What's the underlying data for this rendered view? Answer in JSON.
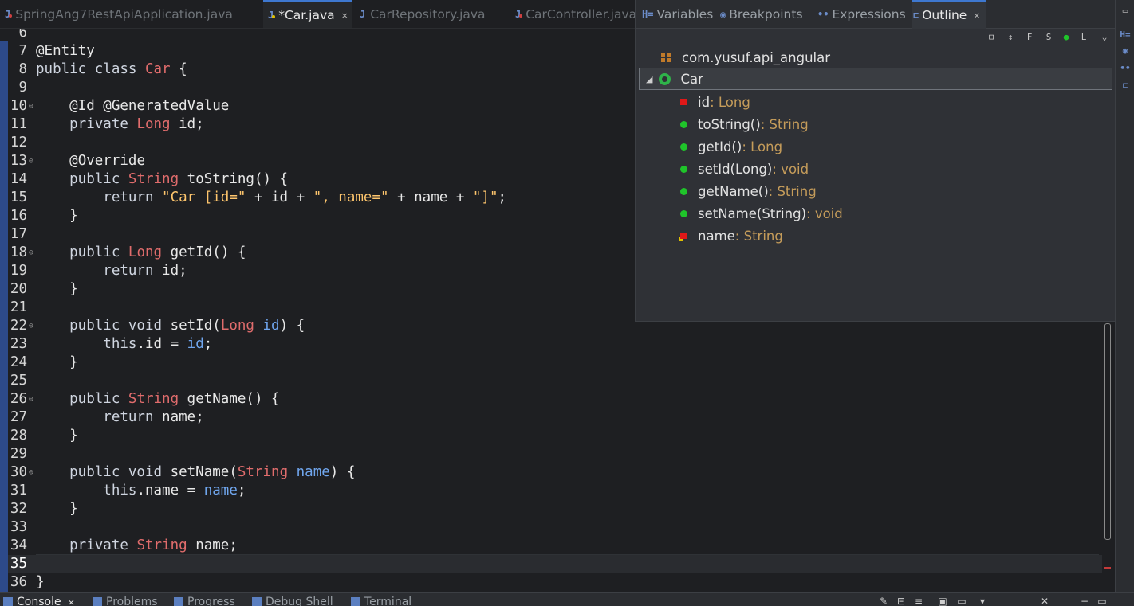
{
  "editor_tabs": [
    {
      "label": "SpringAng7RestApiApplication.java",
      "active": false,
      "marker": "error"
    },
    {
      "label": "*Car.java",
      "active": true,
      "marker": "warning",
      "close": "×"
    },
    {
      "label": "CarRepository.java",
      "active": false,
      "marker": "none"
    },
    {
      "label": "CarController.java",
      "active": false,
      "marker": "error"
    }
  ],
  "outline_tabs": [
    {
      "label": "Variables",
      "icon": "variables-icon",
      "glyph": "H="
    },
    {
      "label": "Breakpoints",
      "icon": "breakpoints-icon",
      "glyph": "◉"
    },
    {
      "label": "Expressions",
      "icon": "expressions-icon",
      "glyph": "••"
    },
    {
      "label": "Outline",
      "icon": "outline-icon",
      "glyph": "⊏",
      "close": "×"
    }
  ],
  "outline_toolbar": [
    "collapse-all-icon",
    "sort-icon",
    "hide-fields-icon",
    "hide-static-icon",
    "hide-nonpublic-icon",
    "hide-local-types-icon",
    "view-menu-icon"
  ],
  "outline": {
    "package": "com.yusuf.api_angular",
    "class_name": "Car",
    "members": [
      {
        "name": "id",
        "suffix": " : Long",
        "kind": "field"
      },
      {
        "name": "toString()",
        "suffix": " : String",
        "kind": "method-override"
      },
      {
        "name": "getId()",
        "suffix": " : Long",
        "kind": "method"
      },
      {
        "name": "setId(Long)",
        "suffix": " : void",
        "kind": "method"
      },
      {
        "name": "getName()",
        "suffix": " : String",
        "kind": "method"
      },
      {
        "name": "setName(String)",
        "suffix": " : void",
        "kind": "method"
      },
      {
        "name": "name",
        "suffix": " : String",
        "kind": "field-warning"
      }
    ]
  },
  "code": {
    "first_line_number": 6,
    "current_line": 35,
    "lines": [
      {
        "n": "6",
        "fold": "",
        "tokens": []
      },
      {
        "n": "7",
        "fold": "",
        "tokens": [
          [
            "ann",
            "@Entity"
          ]
        ]
      },
      {
        "n": "8",
        "fold": "",
        "tokens": [
          [
            "kw",
            "public class "
          ],
          [
            "cl",
            "Car"
          ],
          [
            "pl",
            " {"
          ]
        ]
      },
      {
        "n": "9",
        "fold": "",
        "tokens": []
      },
      {
        "n": "10",
        "fold": "⊖",
        "tokens": [
          [
            "pl",
            "    "
          ],
          [
            "ann",
            "@Id @GeneratedValue"
          ]
        ]
      },
      {
        "n": "11",
        "fold": "",
        "tokens": [
          [
            "kw",
            "    private "
          ],
          [
            "ty",
            "Long"
          ],
          [
            "pl",
            " id;"
          ]
        ]
      },
      {
        "n": "12",
        "fold": "",
        "tokens": []
      },
      {
        "n": "13",
        "fold": "⊖",
        "tokens": [
          [
            "pl",
            "    "
          ],
          [
            "ann",
            "@Override"
          ]
        ]
      },
      {
        "n": "14",
        "fold": "",
        "tokens": [
          [
            "kw",
            "    public "
          ],
          [
            "ty",
            "String"
          ],
          [
            "mth",
            " toString"
          ],
          [
            "pl",
            "() {"
          ]
        ]
      },
      {
        "n": "15",
        "fold": "",
        "tokens": [
          [
            "kw",
            "        return "
          ],
          [
            "str",
            "\"Car [id=\""
          ],
          [
            "pl",
            " + id + "
          ],
          [
            "str",
            "\", name=\""
          ],
          [
            "pl",
            " + name + "
          ],
          [
            "str",
            "\"]\""
          ],
          [
            "pl",
            ";"
          ]
        ]
      },
      {
        "n": "16",
        "fold": "",
        "tokens": [
          [
            "pl",
            "    }"
          ]
        ]
      },
      {
        "n": "17",
        "fold": "",
        "tokens": []
      },
      {
        "n": "18",
        "fold": "⊖",
        "tokens": [
          [
            "kw",
            "    public "
          ],
          [
            "ty",
            "Long"
          ],
          [
            "mth",
            " getId"
          ],
          [
            "pl",
            "() {"
          ]
        ]
      },
      {
        "n": "19",
        "fold": "",
        "tokens": [
          [
            "kw",
            "        return "
          ],
          [
            "pl",
            "id;"
          ]
        ]
      },
      {
        "n": "20",
        "fold": "",
        "tokens": [
          [
            "pl",
            "    }"
          ]
        ]
      },
      {
        "n": "21",
        "fold": "",
        "tokens": []
      },
      {
        "n": "22",
        "fold": "⊖",
        "tokens": [
          [
            "kw",
            "    public void "
          ],
          [
            "mth",
            "setId"
          ],
          [
            "pl",
            "("
          ],
          [
            "ty",
            "Long"
          ],
          [
            "fld",
            " id"
          ],
          [
            "pl",
            ") {"
          ]
        ]
      },
      {
        "n": "23",
        "fold": "",
        "tokens": [
          [
            "kw",
            "        this"
          ],
          [
            "pl",
            ".id = "
          ],
          [
            "fld",
            "id"
          ],
          [
            "pl",
            ";"
          ]
        ]
      },
      {
        "n": "24",
        "fold": "",
        "tokens": [
          [
            "pl",
            "    }"
          ]
        ]
      },
      {
        "n": "25",
        "fold": "",
        "tokens": []
      },
      {
        "n": "26",
        "fold": "⊖",
        "tokens": [
          [
            "kw",
            "    public "
          ],
          [
            "ty",
            "String"
          ],
          [
            "mth",
            " getName"
          ],
          [
            "pl",
            "() {"
          ]
        ]
      },
      {
        "n": "27",
        "fold": "",
        "tokens": [
          [
            "kw",
            "        return "
          ],
          [
            "pl",
            "name;"
          ]
        ]
      },
      {
        "n": "28",
        "fold": "",
        "tokens": [
          [
            "pl",
            "    }"
          ]
        ]
      },
      {
        "n": "29",
        "fold": "",
        "tokens": []
      },
      {
        "n": "30",
        "fold": "⊖",
        "tokens": [
          [
            "kw",
            "    public void "
          ],
          [
            "mth",
            "setName"
          ],
          [
            "pl",
            "("
          ],
          [
            "ty",
            "String"
          ],
          [
            "fld",
            " name"
          ],
          [
            "pl",
            ") {"
          ]
        ]
      },
      {
        "n": "31",
        "fold": "",
        "tokens": [
          [
            "kw",
            "        this"
          ],
          [
            "pl",
            ".name = "
          ],
          [
            "fld",
            "name"
          ],
          [
            "pl",
            ";"
          ]
        ]
      },
      {
        "n": "32",
        "fold": "",
        "tokens": [
          [
            "pl",
            "    }"
          ]
        ]
      },
      {
        "n": "33",
        "fold": "",
        "tokens": []
      },
      {
        "n": "34",
        "fold": "",
        "tokens": [
          [
            "kw",
            "    private "
          ],
          [
            "ty",
            "String"
          ],
          [
            "pl",
            " name;"
          ]
        ]
      },
      {
        "n": "35",
        "fold": "",
        "tokens": []
      },
      {
        "n": "36",
        "fold": "",
        "tokens": [
          [
            "pl",
            "}"
          ]
        ]
      }
    ]
  },
  "bottom_tabs": [
    {
      "label": "Console",
      "active": true,
      "close": "×"
    },
    {
      "label": "Problems",
      "active": false
    },
    {
      "label": "Progress",
      "active": false
    },
    {
      "label": "Debug Shell",
      "active": false
    },
    {
      "label": "Terminal",
      "active": false
    }
  ],
  "window_controls": {
    "restore": "▭",
    "minimize": "−"
  },
  "colors": {
    "accent": "#3e78d0",
    "keyword": "#cfd5e0",
    "type": "#e06c6c",
    "string": "#ffc66d",
    "field": "#70a6ee",
    "method_dot": "#1fc42a",
    "field_square": "#e01818"
  }
}
